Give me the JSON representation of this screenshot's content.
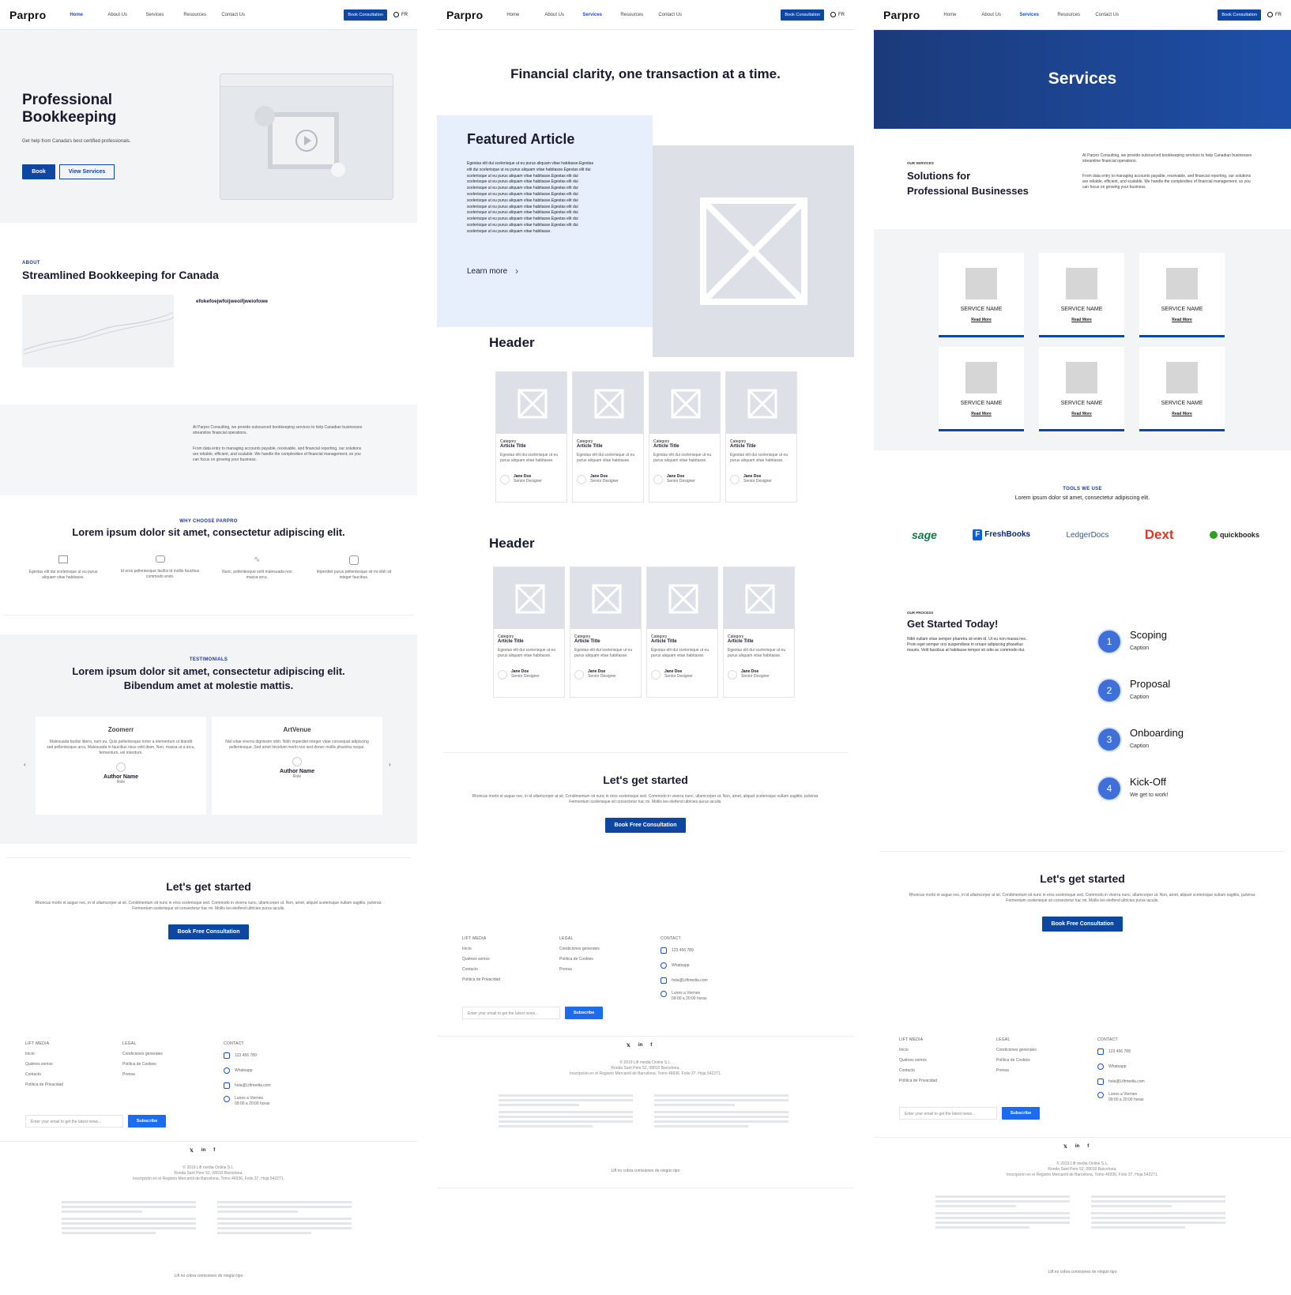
{
  "brand": {
    "logo": "Parpro"
  },
  "nav": {
    "links": [
      "Home",
      "About Us",
      "Services",
      "Resources",
      "Contact Us"
    ],
    "book": "Book Consultation",
    "lang": "FR"
  },
  "home": {
    "hero": {
      "title_1": "Professional",
      "title_2": "Bookkeeping",
      "subtitle": "Get help from Canada's best certified professionals.",
      "btn_book": "Book",
      "btn_services": "View Services"
    },
    "about": {
      "eyebrow": "ABOUT",
      "title": "Streamlined Bookkeeping for Canada",
      "note": "efokefoejwfoijweoifjweiofowe"
    },
    "intro": {
      "p1": "At Parpro Consulting, we provide outsourced bookkeeping services to help Canadian businesses streamline financial operations.",
      "p2": "From data entry to managing accounts payable, receivable, and financial reporting, our solutions are reliable, efficient, and scalable. We handle the complexities of financial management, so you can focus on growing your business."
    },
    "why": {
      "eyebrow": "WHY CHOOSE PARPRO",
      "title": "Lorem ipsum dolor sit amet, consectetur adipiscing elit.",
      "items": [
        "Egestas elit dui scelerisque ut eu purus aliquam vitae habitasse.",
        "Id eros pellentesque facilisi id mollis faucibus commodo enim.",
        "Nunc, pellentesque velit malesuada non massa arcu.",
        "Imperdiet purus pellentesque sit mi nibh sit integer faucibus."
      ]
    },
    "testimonials": {
      "eyebrow": "TESTIMONIALS",
      "title_1": "Lorem ipsum dolor sit amet, consectetur adipiscing elit.",
      "title_2": "Bibendum amet at molestie mattis.",
      "cards": [
        {
          "brand": "Zoomerr",
          "text": "Malesuada facilisi libero, nam eu. Quis pellentesque tortor a elementum ut blandit sed pellentesque arcu. Malesuada in faucibus risus velit diam. Non, massa ut a arcu, fermentum, vel interdum.",
          "author": "Author Name",
          "role": "Role"
        },
        {
          "brand": "ArtVenue",
          "text": "Nisl vitae viverra dignissim nibh. Nibh imperdiet integer vitae consequat adipiscing pellentesque. Sed amet tincidunt morbi non sed donec mollis pharetra neque.",
          "author": "Author Name",
          "role": "Role"
        }
      ]
    }
  },
  "cta": {
    "title": "Let's get started",
    "text": "Rhoncus morbi et augue nec, in id ullamcorper at sit. Condimentum sit nunc in eros scelerisque sed. Commodo in viverra nunc, ullamcorper ut. Non, amet, aliquet scelerisque nullam sagittis, pulvinar. Fermentum scelerisque sit consectetur hac mi. Mollis leo eleifend ultricies purus iaculis.",
    "button": "Book Free Consultation"
  },
  "footer": {
    "col1_title": "LIFT MEDIA",
    "col1": [
      "Inicio",
      "Quiénes somos",
      "Contacto",
      "Política de Privacidad"
    ],
    "col2_title": "LEGAL",
    "col2": [
      "Condiciones generales",
      "Política de Cookies",
      "Prensa"
    ],
    "col3_title": "CONTACT",
    "phone": "123 456 789",
    "whatsapp": "Whatsapp",
    "email": "hola@Liftmedia.com",
    "hours_1": "Lunes a Viernes",
    "hours_2": "09:00 a 20:00 horas",
    "email_placeholder": "Enter your email to get the latest news...",
    "subscribe": "Subscribe",
    "social": [
      "𝕏",
      "in",
      "f"
    ],
    "legal_1": "© 2019 Lift media Online S.L.",
    "legal_2": "Ronda Sant Pere 52, 08010 Barcelona.",
    "legal_3": "Inscripción en el Registro Mercantil de Barcelona, Tomo 46936, Folio 37, Hoja 542271.",
    "bottom": "Lift no cobra comisiones de ningún tipo"
  },
  "resources": {
    "headline": "Financial clarity, one transaction at a time.",
    "featured": {
      "title": "Featured Article",
      "body": "Egestas elit dui scelerisque ut eu purus aliquam vitae habitasse.Egestas elit dui scelerisque ut eu purus aliquam vitae habitasse.Egestas elit dui scelerisque ut eu purus aliquam vitae habitasse.Egestas elit dui scelerisque ut eu purus aliquam vitae habitasse.Egestas elit dui scelerisque ut eu purus aliquam vitae habitasse.Egestas elit dui scelerisque ut eu purus aliquam vitae habitasse.Egestas elit dui scelerisque ut eu purus aliquam vitae habitasse.Egestas elit dui scelerisque ut eu purus aliquam vitae habitasse.Egestas elit dui scelerisque ut eu purus aliquam vitae habitasse.Egestas elit dui scelerisque ut eu purus aliquam vitae habitasse.Egestas elit dui scelerisque ut eu purus aliquam vitae habitasse.Egestas elit dui scelerisque ut eu purus aliquam vitae habitasse.",
      "learn_more": "Learn more"
    },
    "section_header": "Header",
    "article": {
      "category": "Category",
      "title": "Article Title",
      "text": "Egestas elit dui scelerisque ut eu purus aliquam vitae habitasse.",
      "author": "Jane Doe",
      "role": "Senior Designer"
    }
  },
  "services": {
    "banner": "Services",
    "eyebrow": "OUR SERVICES",
    "title_1": "Solutions for",
    "title_2": "Professional Businesses",
    "p1": "At Parpro Consulting, we provide outsourced bookkeeping services to help Canadian businesses streamline financial operations.",
    "p2": "From data entry to managing accounts payable, receivable, and financial reporting, our solutions are reliable, efficient, and scalable. We handle the complexities of financial management, so you can focus on growing your business.",
    "card_name": "SERVICE NAME",
    "card_link": "Read More",
    "tools_eyebrow": "TOOLS WE USE",
    "tools_text": "Lorem ipsum dolor sit amet, consectetur adipiscing elit.",
    "tools": [
      "sage",
      "FreshBooks",
      "LedgerDocs",
      "Dext",
      "quickbooks"
    ],
    "process_eyebrow": "OUR PROCESS",
    "process_title": "Get Started Today!",
    "process_text": "Nibh nullam vitae semper pharetra sit enim id. Ut eu non massa nec. Proin eget semper orci suspendisse in ornare adipiscing phasellus mauris. Velit faucibus at habitasse tempor sit odio ac commodo dui.",
    "steps": [
      {
        "n": "1",
        "t": "Scoping",
        "c": "Caption"
      },
      {
        "n": "2",
        "t": "Proposal",
        "c": "Caption"
      },
      {
        "n": "3",
        "t": "Onboarding",
        "c": "Caption"
      },
      {
        "n": "4",
        "t": "Kick-Off",
        "c": "We get to work!"
      }
    ]
  },
  "colors": {
    "primary": "#0d47a1",
    "accent": "#1d6cf0",
    "banner": "#1e3f8a"
  }
}
